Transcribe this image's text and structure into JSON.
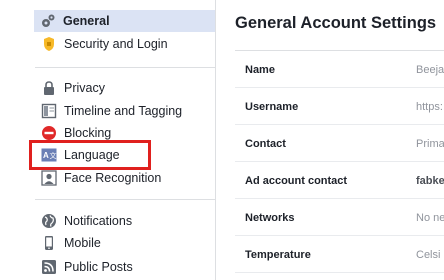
{
  "sidebar": {
    "items": [
      {
        "label": "General",
        "icon": "gears-icon",
        "active": true
      },
      {
        "label": "Security and Login",
        "icon": "shield-icon"
      },
      {
        "label": "Privacy",
        "icon": "lock-icon"
      },
      {
        "label": "Timeline and Tagging",
        "icon": "timeline-icon"
      },
      {
        "label": "Blocking",
        "icon": "block-icon"
      },
      {
        "label": "Language",
        "icon": "language-icon"
      },
      {
        "label": "Face Recognition",
        "icon": "face-recognition-icon"
      },
      {
        "label": "Notifications",
        "icon": "globe-icon"
      },
      {
        "label": "Mobile",
        "icon": "mobile-icon"
      },
      {
        "label": "Public Posts",
        "icon": "rss-icon"
      }
    ],
    "highlighted_item": "Language",
    "highlight_color": "#e0201e"
  },
  "main": {
    "title": "General Account Settings",
    "rows": [
      {
        "key": "Name",
        "value": "Beeja"
      },
      {
        "key": "Username",
        "value": "https:"
      },
      {
        "key": "Contact",
        "value": "Prima"
      },
      {
        "key": "Ad account contact",
        "value": "fabke",
        "bold": true
      },
      {
        "key": "Networks",
        "value": "No ne"
      },
      {
        "key": "Temperature",
        "value": "Celsi"
      }
    ]
  },
  "colors": {
    "active_bg": "#dbe3f4",
    "divider": "#dddfe2",
    "muted_text": "#90949c"
  }
}
